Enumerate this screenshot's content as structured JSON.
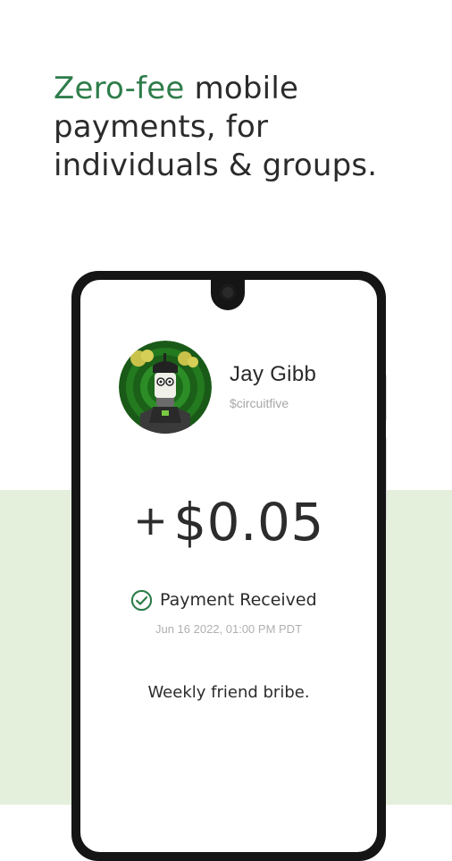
{
  "headline": {
    "accent": "Zero-fee",
    "rest": " mobile payments, for individuals & groups."
  },
  "profile": {
    "name": "Jay Gibb",
    "handle": "$circuitfive",
    "avatar_icon": "avatar-illustration"
  },
  "transaction": {
    "sign": "+",
    "amount": "$0.05",
    "status": "Payment Received",
    "status_icon": "check-circle-icon",
    "timestamp": "Jun 16 2022, 01:00 PM PDT",
    "note": "Weekly friend bribe."
  },
  "colors": {
    "accent": "#2e7d4a",
    "background_band": "#e4efdc",
    "text": "#2c2c2c",
    "muted": "#a7a7a7"
  }
}
